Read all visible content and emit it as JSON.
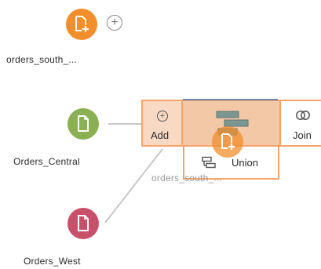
{
  "nodes": {
    "south": {
      "label": "orders_south_...",
      "color": "#f28e2b",
      "icon": "file-add-icon"
    },
    "central": {
      "label": "Orders_Central",
      "color": "#8bb054",
      "icon": "file-icon"
    },
    "west": {
      "label": "Orders_West",
      "color": "#c9506a",
      "icon": "file-icon"
    }
  },
  "add_step": {
    "icon": "plus-circle-icon"
  },
  "drop_targets": {
    "add": {
      "label": "Add",
      "icon": "plus-circle-icon"
    },
    "join": {
      "label": "Join",
      "icon": "join-icon"
    },
    "union": {
      "label": "Union",
      "icon": "union-icon"
    }
  },
  "dragging": {
    "label": "orders_south_...",
    "icon": "file-add-icon"
  },
  "colors": {
    "drop_highlight": "#f8d9c3",
    "drop_border": "#f4a46b"
  }
}
